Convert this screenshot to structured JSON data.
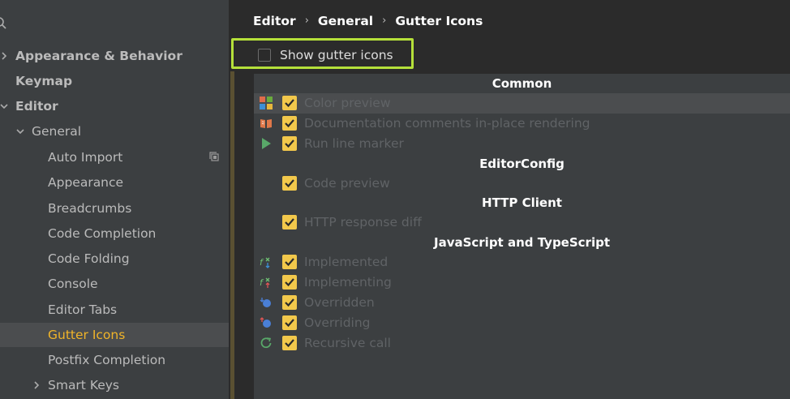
{
  "sidebar": {
    "items": [
      {
        "label": "Appearance & Behavior",
        "bold": true
      },
      {
        "label": "Keymap",
        "bold": true
      },
      {
        "label": "Editor",
        "bold": true
      },
      {
        "label": "General",
        "bold": false
      },
      {
        "label": "Auto Import"
      },
      {
        "label": "Appearance"
      },
      {
        "label": "Breadcrumbs"
      },
      {
        "label": "Code Completion"
      },
      {
        "label": "Code Folding"
      },
      {
        "label": "Console"
      },
      {
        "label": "Editor Tabs"
      },
      {
        "label": "Gutter Icons",
        "selected": true
      },
      {
        "label": "Postfix Completion"
      },
      {
        "label": "Smart Keys"
      }
    ]
  },
  "breadcrumb": [
    "Editor",
    "General",
    "Gutter Icons"
  ],
  "breadcrumb_separator": "›",
  "show_gutter_icons": {
    "label": "Show gutter icons",
    "checked": false
  },
  "groups": [
    {
      "title": "Common"
    },
    {
      "title": "EditorConfig"
    },
    {
      "title": "HTTP Client"
    },
    {
      "title": "JavaScript and TypeScript"
    }
  ],
  "rows": [
    {
      "label": "Color preview",
      "icon": "color-palette-icon",
      "checked": true
    },
    {
      "label": "Documentation comments in-place rendering",
      "icon": "book-icon",
      "checked": true
    },
    {
      "label": "Run line marker",
      "icon": "run-icon",
      "checked": true
    },
    {
      "label": "Code preview",
      "icon": "",
      "checked": true
    },
    {
      "label": "HTTP response diff",
      "icon": "",
      "checked": true
    },
    {
      "label": "Implemented",
      "icon": "implemented-icon",
      "checked": true
    },
    {
      "label": "Implementing",
      "icon": "implementing-icon",
      "checked": true
    },
    {
      "label": "Overridden",
      "icon": "overridden-icon",
      "checked": true
    },
    {
      "label": "Overriding",
      "icon": "overriding-icon",
      "checked": true
    },
    {
      "label": "Recursive call",
      "icon": "recursive-call-icon",
      "checked": true
    }
  ],
  "colors": {
    "accent_selected_text": "#f0b429",
    "checkbox_fill": "#f2c84b",
    "highlight_box": "#b5e03a"
  }
}
